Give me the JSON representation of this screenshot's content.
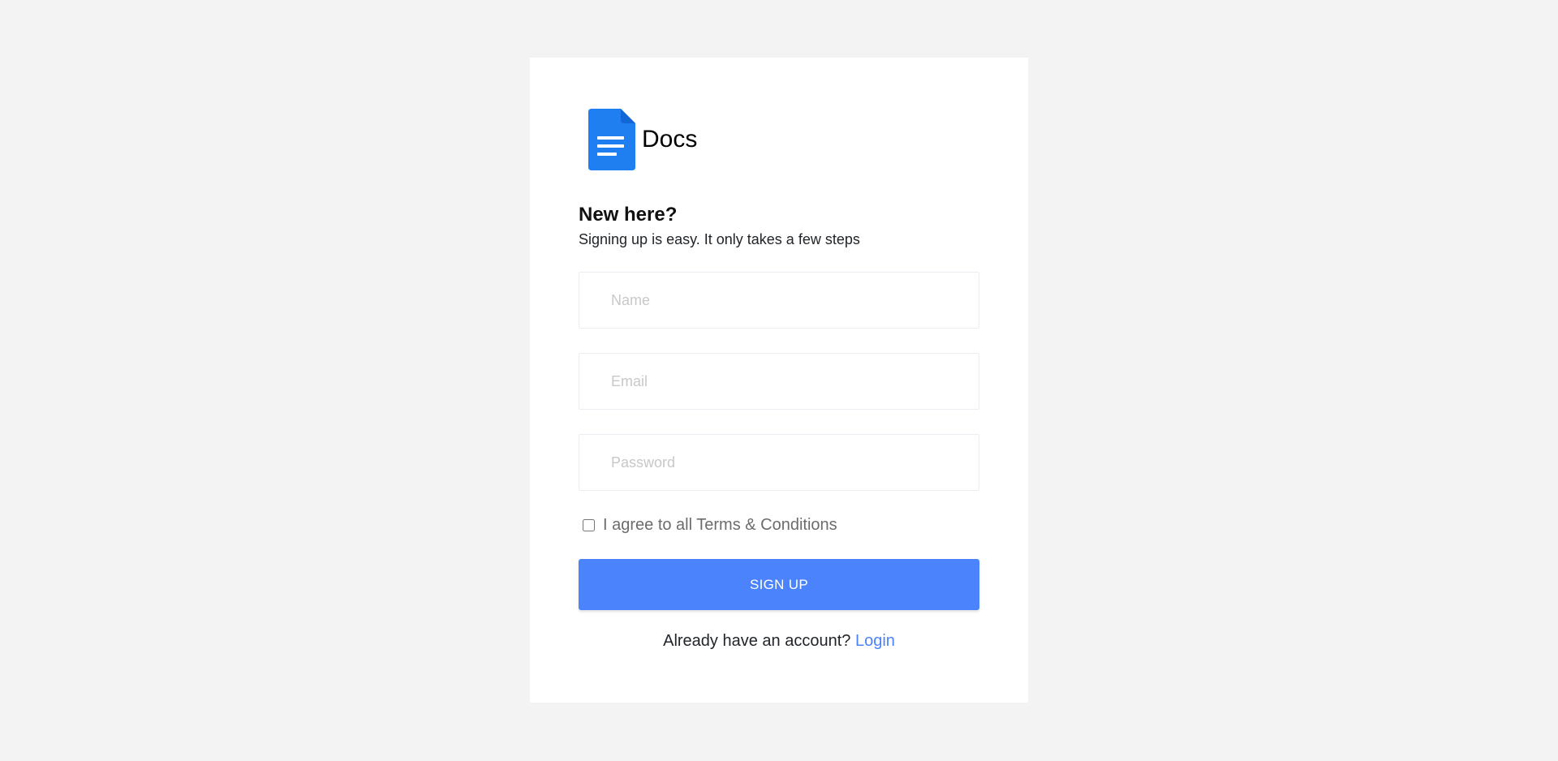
{
  "brand": {
    "name": "Docs",
    "icon": "document-icon",
    "icon_color": "#1f7ff0"
  },
  "form": {
    "heading": "New here?",
    "subheading": "Signing up is easy. It only takes a few steps",
    "name_placeholder": "Name",
    "name_value": "",
    "email_placeholder": "Email",
    "email_value": "",
    "password_placeholder": "Password",
    "password_value": "",
    "terms_label": "I agree to all Terms & Conditions",
    "terms_checked": false,
    "signup_label": "SIGN UP",
    "login_prompt": "Already have an account?",
    "login_label": "Login"
  },
  "colors": {
    "page_background": "#f3f3f3",
    "accent": "#4b83fc"
  }
}
